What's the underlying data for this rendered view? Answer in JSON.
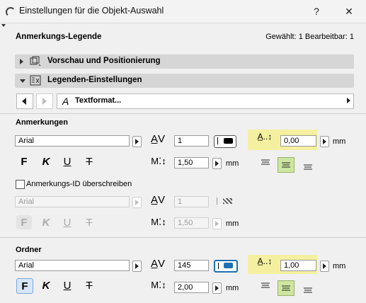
{
  "window": {
    "title": "Einstellungen für die Objekt-Auswahl",
    "help": "?",
    "close": "✕"
  },
  "header": {
    "title": "Anmerkungs-Legende",
    "status": "Gewählt: 1 Bearbeitbar: 1"
  },
  "sections": {
    "preview": {
      "label": "Vorschau und Positionierung",
      "expanded": false
    },
    "legend": {
      "label": "Legenden-Einstellungen",
      "expanded": true
    }
  },
  "navbar": {
    "value": "Textformat...",
    "prefix_glyph": "A"
  },
  "anmerkungen": {
    "label": "Anmerkungen",
    "font": "Arial",
    "spacing": "1",
    "leading": "1,50",
    "offset": "0,00",
    "unit": "mm",
    "color": "#000000"
  },
  "override": {
    "label": "Anmerkungs-ID überschreiben",
    "checked": false,
    "font": "Arial",
    "spacing": "1",
    "leading": "1,50",
    "unit": "mm"
  },
  "ordner": {
    "label": "Ordner",
    "font": "Arial",
    "spacing": "145",
    "leading": "2,00",
    "offset": "1,00",
    "unit": "mm",
    "color": "#1e6fb5"
  },
  "format_glyphs": {
    "bold": "F",
    "italic": "K",
    "underline": "U",
    "strike": "T"
  },
  "colors": {
    "highlight": "#f5f0a0",
    "active_align": "#cde6a0",
    "ordner_bold_bg": "#d6e6f7"
  }
}
